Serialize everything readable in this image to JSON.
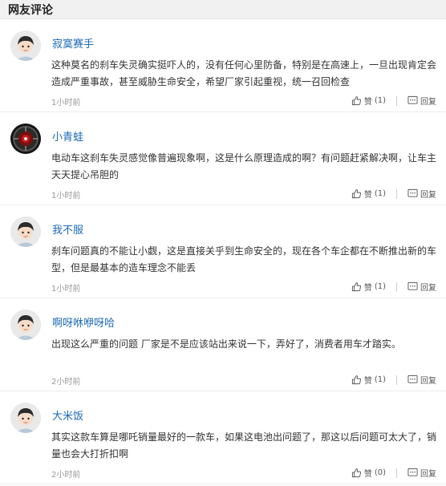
{
  "header": {
    "title": "网友评论"
  },
  "comments": [
    {
      "username": "寂寞赛手",
      "text": "这种莫名的刹车失灵确实挺吓人的，没有任何心里防备，特别是在高速上，一旦出现肯定会造成严重事故，甚至威胁生命安全，希望厂家引起重视，统一召回检查",
      "time": "1小时前",
      "like_label": "赞",
      "like_count": "(1)",
      "reply_label": "回复",
      "avatar": "cartoon-boy"
    },
    {
      "username": "小青蛙",
      "text": "电动车这刹车失灵感觉像普遍现象啊，这是什么原理造成的啊？有问题赶紧解决啊，让车主天天提心吊胆的",
      "time": "1小时前",
      "like_label": "赞",
      "like_count": "(1)",
      "reply_label": "回复",
      "avatar": "dark-wheel"
    },
    {
      "username": "我不服",
      "text": "刹车问题真的不能让小觑，这是直接关乎到生命安全的，现在各个车企都在不断推出新的车型，但是最基本的造车理念不能丢",
      "time": "1小时前",
      "like_label": "赞",
      "like_count": "(1)",
      "reply_label": "回复",
      "avatar": "cartoon-boy"
    },
    {
      "username": "啊呀咻咿呀哈",
      "text": "出现这么严重的问题 厂家是不是应该站出来说一下，弄好了，消费者用车才踏实。",
      "time": "2小时前",
      "like_label": "赞",
      "like_count": "(1)",
      "reply_label": "回复",
      "avatar": "cartoon-boy"
    },
    {
      "username": "大米饭",
      "text": "其实这款车算是哪吒销量最好的一款车，如果这电池出问题了，那这以后问题可太大了，销量也会大打折扣啊",
      "time": "2小时前",
      "like_label": "赞",
      "like_count": "(0)",
      "reply_label": "回复",
      "avatar": "cartoon-boy"
    }
  ]
}
